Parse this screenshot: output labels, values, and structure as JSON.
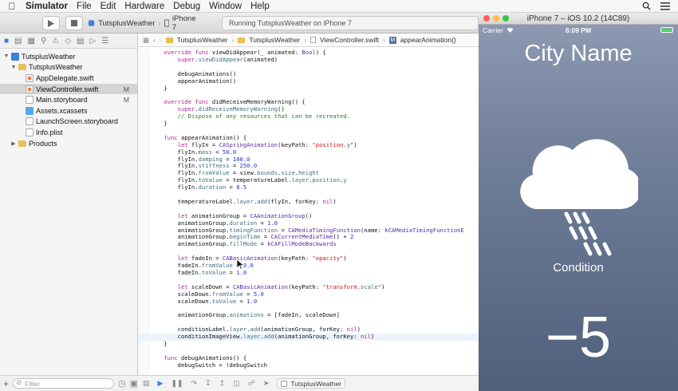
{
  "menubar": {
    "app": "Simulator",
    "items": [
      "File",
      "Edit",
      "Hardware",
      "Debug",
      "Window",
      "Help"
    ]
  },
  "toolbar": {
    "scheme": "TutsplusWeather",
    "device": "iPhone 7",
    "status": "Running TutsplusWeather on iPhone 7"
  },
  "navigator": {
    "filter_placeholder": "Filter",
    "tree": [
      {
        "label": "TutsplusWeather",
        "icon": "project",
        "depth": 0,
        "disclosure": "open"
      },
      {
        "label": "TutsplusWeather",
        "icon": "folder",
        "depth": 1,
        "disclosure": "open"
      },
      {
        "label": "AppDelegate.swift",
        "icon": "swift",
        "depth": 2
      },
      {
        "label": "ViewController.swift",
        "icon": "swift",
        "depth": 2,
        "badge": "M",
        "selected": true
      },
      {
        "label": "Main.storyboard",
        "icon": "storyboard",
        "depth": 2,
        "badge": "M"
      },
      {
        "label": "Assets.xcassets",
        "icon": "assets",
        "depth": 2
      },
      {
        "label": "LaunchScreen.storyboard",
        "icon": "storyboard",
        "depth": 2
      },
      {
        "label": "Info.plist",
        "icon": "plist",
        "depth": 2
      },
      {
        "label": "Products",
        "icon": "folder",
        "depth": 1,
        "disclosure": "closed"
      }
    ]
  },
  "editor": {
    "jumpbar": [
      "TutsplusWeather",
      "TutsplusWeather",
      "ViewController.swift",
      "appearAnimation()"
    ],
    "code": [
      "    override func viewDidAppear(_ animated: Bool) {",
      "        super.viewDidAppear(animated)",
      "",
      "        debugAnimations()",
      "        appearAnimation()",
      "    }",
      "",
      "    override func didReceiveMemoryWarning() {",
      "        super.didReceiveMemoryWarning()",
      "        // Dispose of any resources that can be recreated.",
      "    }",
      "",
      "    func appearAnimation() {",
      "        let flyIn = CASpringAnimation(keyPath: \"position.y\")",
      "        flyIn.mass = 50.0",
      "        flyIn.damping = 100.0",
      "        flyIn.stiffness = 250.0",
      "        flyIn.fromValue = view.bounds.size.height",
      "        flyIn.toValue = temperatureLabel.layer.position.y",
      "        flyIn.duration = 8.5",
      "",
      "        temperatureLabel.layer.add(flyIn, forKey: nil)",
      "",
      "        let animationGroup = CAAnimationGroup()",
      "        animationGroup.duration = 1.0",
      "        animationGroup.timingFunction = CAMediaTimingFunction(name: kCAMediaTimingFunctionE",
      "        animationGroup.beginTime = CACurrentMediaTime() + 2",
      "        animationGroup.fillMode = kCAFillModeBackwards",
      "",
      "        let fadeIn = CABasicAnimation(keyPath: \"opacity\")",
      "        fadeIn.fromValue = 0.0",
      "        fadeIn.toValue = 1.0",
      "",
      "        let scaleDown = CABasicAnimation(keyPath: \"transform.scale\")",
      "        scaleDown.fromValue = 5.0",
      "        scaleDown.toValue = 1.0",
      "",
      "        animationGroup.animations = [fadeIn, scaleDown]",
      "",
      "        conditionLabel.layer.add(animationGroup, forKey: nil)",
      "        conditionImageView.layer.add(animationGroup, forKey: nil)",
      "    }",
      "",
      "    func debugAnimations() {",
      "        debugSwitch = !debugSwitch"
    ],
    "current_line": 40,
    "debug_target": "TutsplusWeather"
  },
  "simulator": {
    "window_title": "iPhone 7 – iOS 10.2 (14C89)",
    "carrier": "Carrier",
    "time": "6:09 PM",
    "city": "City Name",
    "condition": "Condition",
    "temperature": "−5",
    "weather_icon": "cloud-rain-icon"
  },
  "colors": {
    "keyword": "#b5219c",
    "type": "#5b2aa3",
    "property": "#3e6d7f",
    "number": "#2430d6",
    "string": "#c41a16",
    "comment": "#237f2a",
    "selection": "#d4d4d4",
    "accent": "#2d7ef5"
  }
}
